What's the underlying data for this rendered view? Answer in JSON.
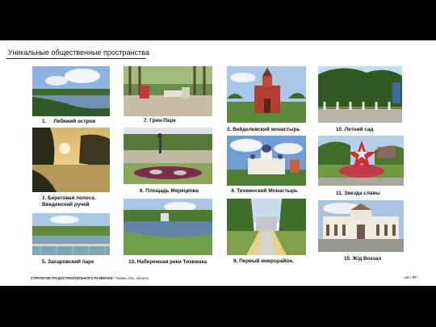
{
  "title": "Уникальные общественные пространства",
  "places": [
    {
      "number": "1.",
      "name": "Лебяжий остров"
    },
    {
      "number": "2.",
      "name": "Береговая полоса. Введенский ручей"
    },
    {
      "number": "5.",
      "name": "Захаровский парк"
    },
    {
      "number": "7.",
      "name": "Грин-Парк"
    },
    {
      "number": "8.",
      "name": "Площадь Мерецкова"
    },
    {
      "number": "13.",
      "name": "Набережная реки Тихвинка"
    },
    {
      "number": "3.",
      "name": "Вейделевский монастырь"
    },
    {
      "number": "4.",
      "name": "Тихвинский Монастырь"
    },
    {
      "number": "9.",
      "name": "Первый микрорайон."
    },
    {
      "number": "10.",
      "name": "Летний сад"
    },
    {
      "number": "11.",
      "name": "Звезда славы"
    },
    {
      "number": "15.",
      "name": "Ж/д Вокзал"
    }
  ],
  "footer": {
    "strategy": "СТРАТЕГИЯ ГРАДОСТРОИТЕЛЬНОГО РАЗВИТИЯ",
    "separator": "/",
    "location": "Тихвин, Лен. область",
    "sheet_label": "лист",
    "sheet_number": "07"
  }
}
